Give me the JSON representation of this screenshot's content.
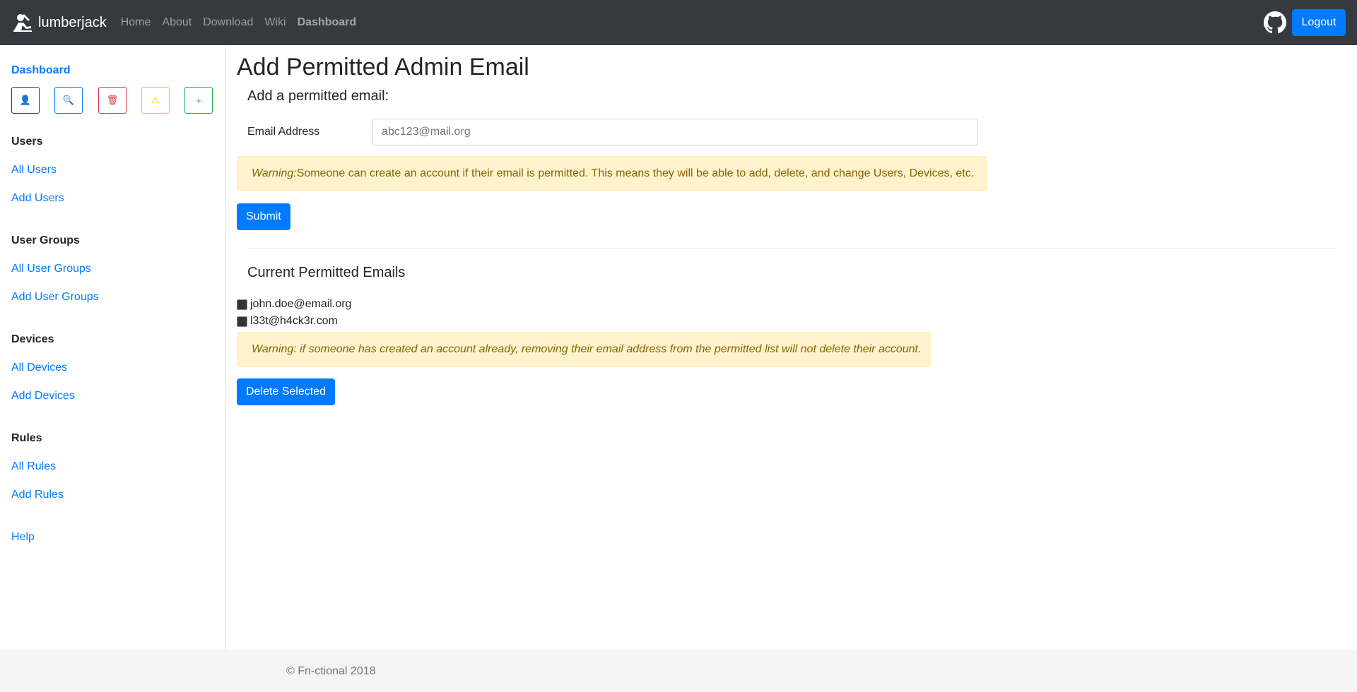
{
  "navbar": {
    "brand": "lumberjack",
    "links": [
      "Home",
      "About",
      "Download",
      "Wiki",
      "Dashboard"
    ],
    "active_link": "Dashboard",
    "logout_label": "Logout"
  },
  "sidebar": {
    "dashboard_label": "Dashboard",
    "quick_buttons": [
      {
        "icon": "user-icon",
        "glyph": "👤",
        "color": "#343a40"
      },
      {
        "icon": "search-icon",
        "glyph": "🔍",
        "color": "#007bff"
      },
      {
        "icon": "trash-icon",
        "glyph": "🗑",
        "color": "#dc3545"
      },
      {
        "icon": "warning-icon",
        "glyph": "⚠",
        "color": "#ffc107"
      },
      {
        "icon": "plus-icon",
        "glyph": "+",
        "color": "#28a745"
      }
    ],
    "sections": [
      {
        "heading": "Users",
        "links": [
          "All Users",
          "Add Users"
        ]
      },
      {
        "heading": "User Groups",
        "links": [
          "All User Groups",
          "Add User Groups"
        ]
      },
      {
        "heading": "Devices",
        "links": [
          "All Devices",
          "Add Devices"
        ]
      },
      {
        "heading": "Rules",
        "links": [
          "All Rules",
          "Add Rules"
        ]
      }
    ],
    "help_label": "Help"
  },
  "main": {
    "page_title": "Add Permitted Admin Email",
    "add_section_title": "Add a permitted email:",
    "email_label": "Email Address",
    "email_placeholder": "abc123@mail.org",
    "warning1_prefix": "Warning:",
    "warning1_text": " Someone can create an account if their email is permitted. This means they will be able to add, delete, and change Users, Devices, etc.",
    "submit_label": "Submit",
    "current_section_title": "Current Permitted Emails",
    "emails": [
      "john.doe@email.org",
      "l33t@h4ck3r.com"
    ],
    "warning2_text": "Warning: if someone has created an account already, removing their email address from the permitted list will not delete their account.",
    "delete_label": "Delete Selected"
  },
  "footer": {
    "text": "© Fn-ctional 2018"
  }
}
